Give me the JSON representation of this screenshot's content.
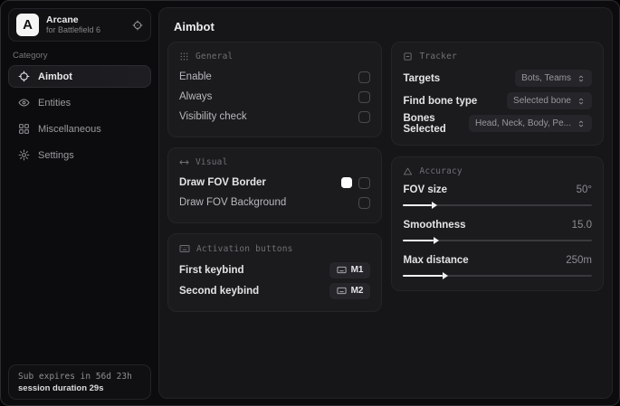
{
  "brand": {
    "logo_letter": "A",
    "name": "Arcane",
    "subtitle": "for Battlefield 6"
  },
  "sidebar": {
    "category_label": "Category",
    "items": [
      {
        "label": "Aimbot",
        "icon": "crosshair-icon",
        "active": true
      },
      {
        "label": "Entities",
        "icon": "eye-icon",
        "active": false
      },
      {
        "label": "Miscellaneous",
        "icon": "grid-icon",
        "active": false
      },
      {
        "label": "Settings",
        "icon": "gear-icon",
        "active": false
      }
    ],
    "footer": {
      "line1": "Sub expires in 56d 23h",
      "line2": "session duration 29s"
    }
  },
  "main": {
    "title": "Aimbot",
    "general": {
      "title": "General",
      "rows": [
        {
          "label": "Enable",
          "checked": false
        },
        {
          "label": "Always",
          "checked": false
        },
        {
          "label": "Visibility check",
          "checked": false
        }
      ]
    },
    "visual": {
      "title": "Visual",
      "rows": [
        {
          "label": "Draw FOV Border",
          "checked": false,
          "swatch": "#ffffff"
        },
        {
          "label": "Draw FOV Background",
          "checked": false
        }
      ]
    },
    "activation": {
      "title": "Activation buttons",
      "rows": [
        {
          "label": "First keybind",
          "key": "M1"
        },
        {
          "label": "Second keybind",
          "key": "M2"
        }
      ]
    },
    "tracker": {
      "title": "Tracker",
      "rows": [
        {
          "label": "Targets",
          "value": "Bots, Teams"
        },
        {
          "label": "Find bone type",
          "value": "Selected bone"
        },
        {
          "label": "Bones Selected",
          "value": "Head, Neck, Body, Pe..."
        }
      ]
    },
    "accuracy": {
      "title": "Accuracy",
      "rows": [
        {
          "label": "FOV size",
          "value": "50°",
          "fill": "15%"
        },
        {
          "label": "Smoothness",
          "value": "15.0",
          "fill": "16%"
        },
        {
          "label": "Max distance",
          "value": "250m",
          "fill": "21%"
        }
      ]
    }
  },
  "colors": {
    "window_bg": "#0c0c0e",
    "panel_bg": "#161618",
    "card_bg": "#1b1b1e",
    "accent_text": "#ececee",
    "fov_border_color": "#ffffff"
  }
}
